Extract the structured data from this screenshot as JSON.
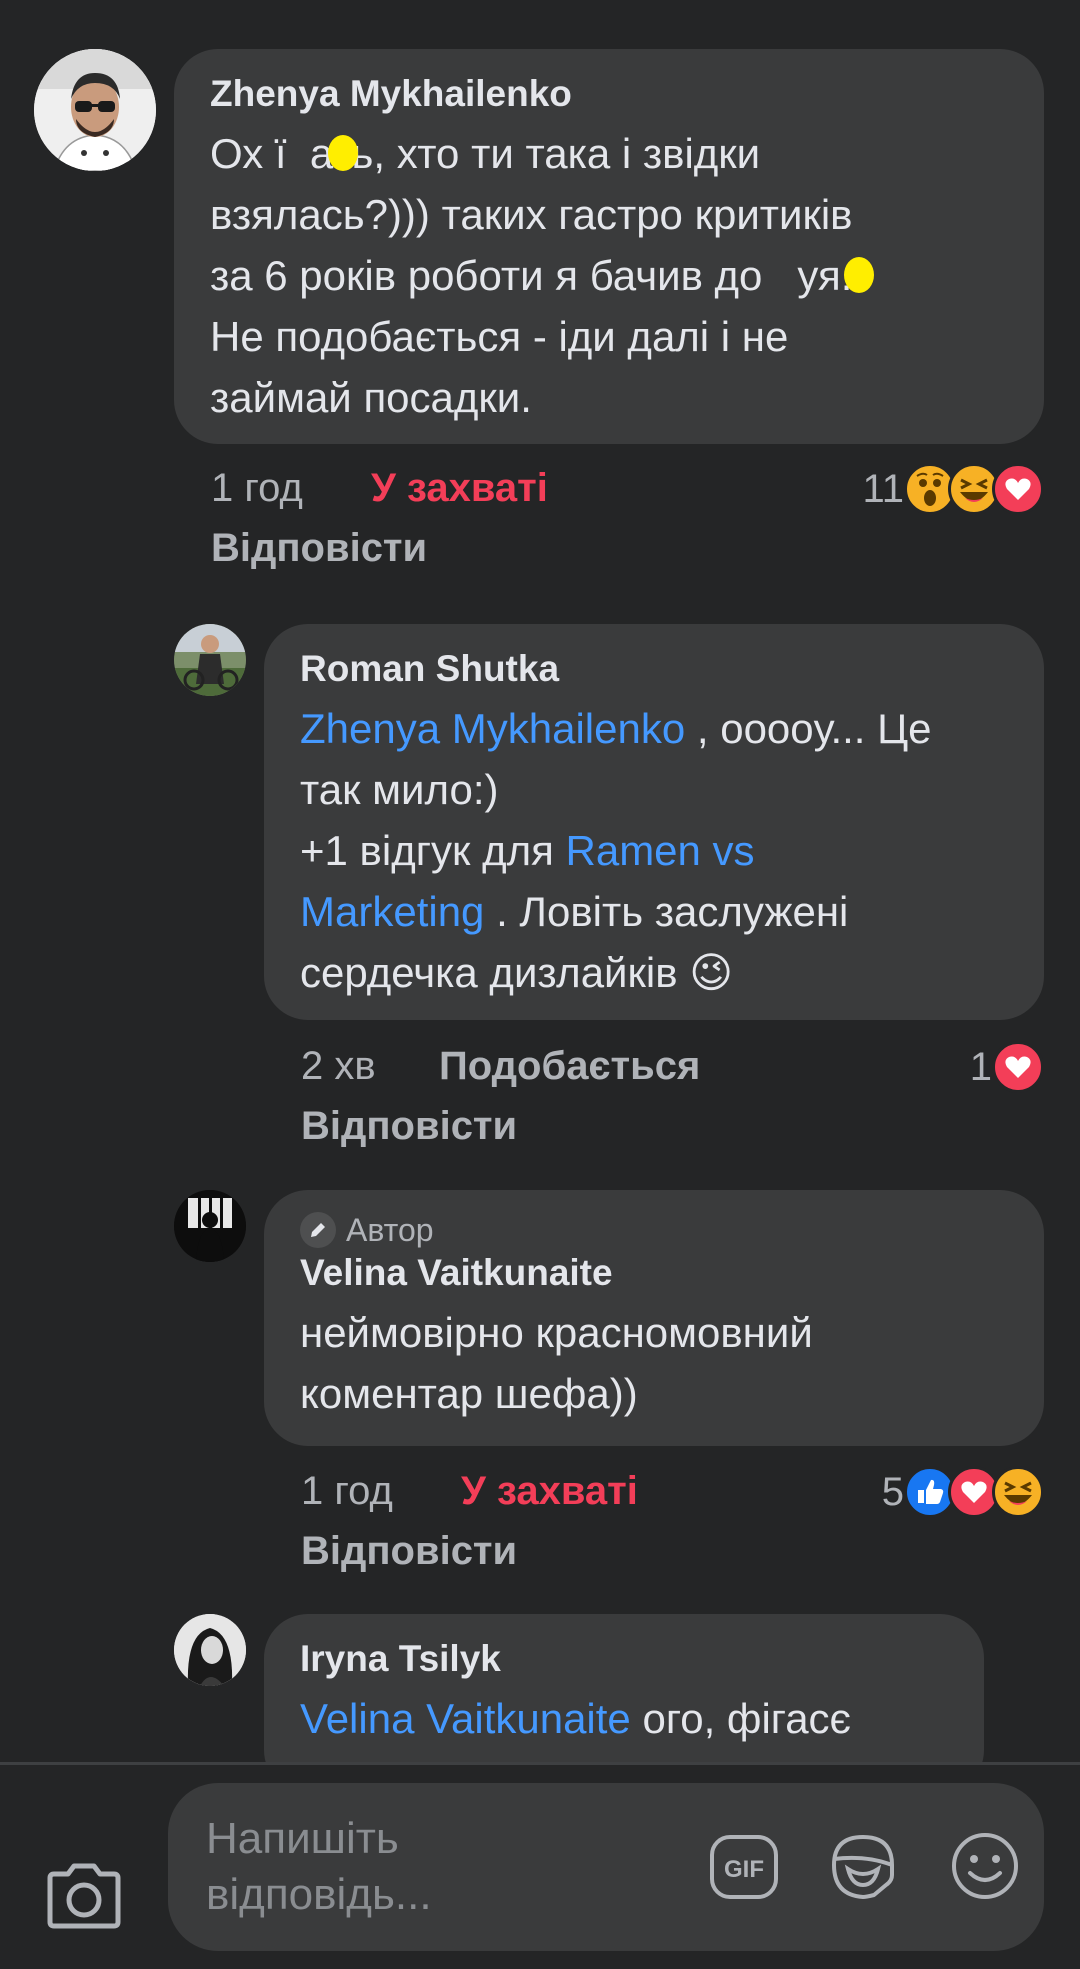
{
  "comments": [
    {
      "author": "Zhenya Mykhailenko",
      "lines": [
        "Ох ї  ать, хто ти така і звідки",
        "взялась?))) таких гастро критиків",
        "за 6 років роботи я бачив до   уя.",
        "Не подобається - іди далі і не",
        "займай посадки."
      ],
      "time": "1 год",
      "reaction_label": "У захваті",
      "reaction_count": "11",
      "reply_label": "Відповісти"
    },
    {
      "author": "Roman Shutka",
      "mention1": "Zhenya Mykhailenko",
      "text1": " , оооoу... Це",
      "text2": "так мило:)",
      "text3": "+1 відгук для ",
      "mention2a": "Ramen vs",
      "mention2b": "Marketing",
      "text4": " . Ловіть заслужені",
      "text5": "сердечка дизлайків ",
      "emoji": "😉",
      "time": "2 хв",
      "reaction_label": "Подобається",
      "reaction_count": "1",
      "reply_label": "Відповісти"
    },
    {
      "badge": "Автор",
      "author": "Velina Vaitkunaite",
      "lines": [
        "неймовірно красномовний",
        "коментар шефа))"
      ],
      "time": "1 год",
      "reaction_label": "У захваті",
      "reaction_count": "5",
      "reply_label": "Відповісти"
    },
    {
      "author": "Iryna Tsilyk",
      "mention": "Velina Vaitkunaite",
      "text": " ого, фігасє"
    }
  ],
  "composer": {
    "placeholder_line1": "Напишіть",
    "placeholder_line2": "відповідь..."
  },
  "colors": {
    "background": "#242526",
    "bubble": "#3a3b3c",
    "mention": "#4599ff",
    "love": "#f33e58",
    "like": "#1877f2",
    "haha": "#f7b125",
    "censor": "#ffee00"
  }
}
